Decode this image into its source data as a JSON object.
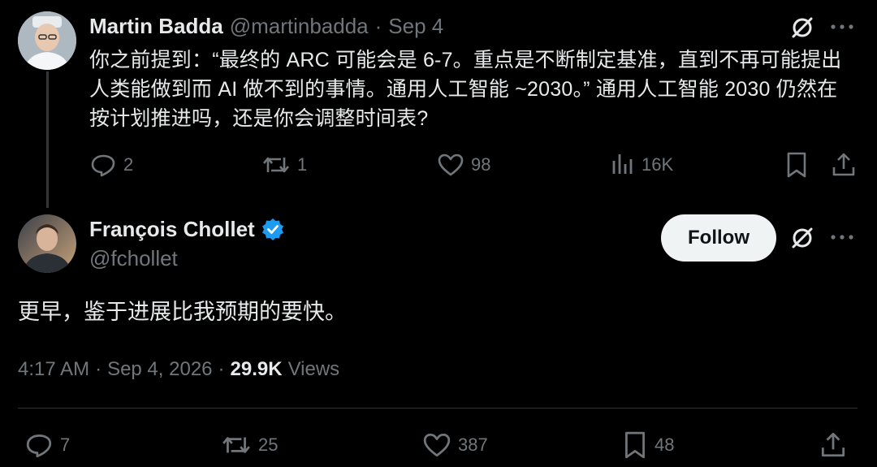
{
  "parent_tweet": {
    "author_name": "Martin Badda",
    "handle": "@martinbadda",
    "separator": "·",
    "date": "Sep 4",
    "text": "你之前提到：“最终的 ARC 可能会是 6-7。重点是不断制定基准，直到不再可能提出人类能做到而 AI 做不到的事情。通用人工智能 ~2030。” 通用人工智能 2030 仍然在按计划推进吗，还是你会调整时间表?",
    "stats": {
      "replies": "2",
      "reposts": "1",
      "likes": "98",
      "views": "16K"
    }
  },
  "main_tweet": {
    "author_name": "François Chollet",
    "handle": "@fchollet",
    "follow_label": "Follow",
    "text": "更早，鉴于进展比我预期的要快。",
    "time": "4:17 AM",
    "dot": "·",
    "date": "Sep 4, 2026",
    "dot2": "·",
    "views_count": "29.9K",
    "views_label": "Views",
    "stats": {
      "replies": "7",
      "reposts": "25",
      "likes": "387",
      "bookmarks": "48"
    }
  },
  "icons": [
    "grok-icon",
    "more-icon",
    "reply-icon",
    "repost-icon",
    "like-icon",
    "views-icon",
    "bookmark-icon",
    "share-icon",
    "verified-badge-icon"
  ],
  "colors": {
    "background": "#000000",
    "text": "#e7e9ea",
    "muted": "#71767b",
    "verified": "#1d9bf0",
    "follow_bg": "#eff3f4"
  }
}
